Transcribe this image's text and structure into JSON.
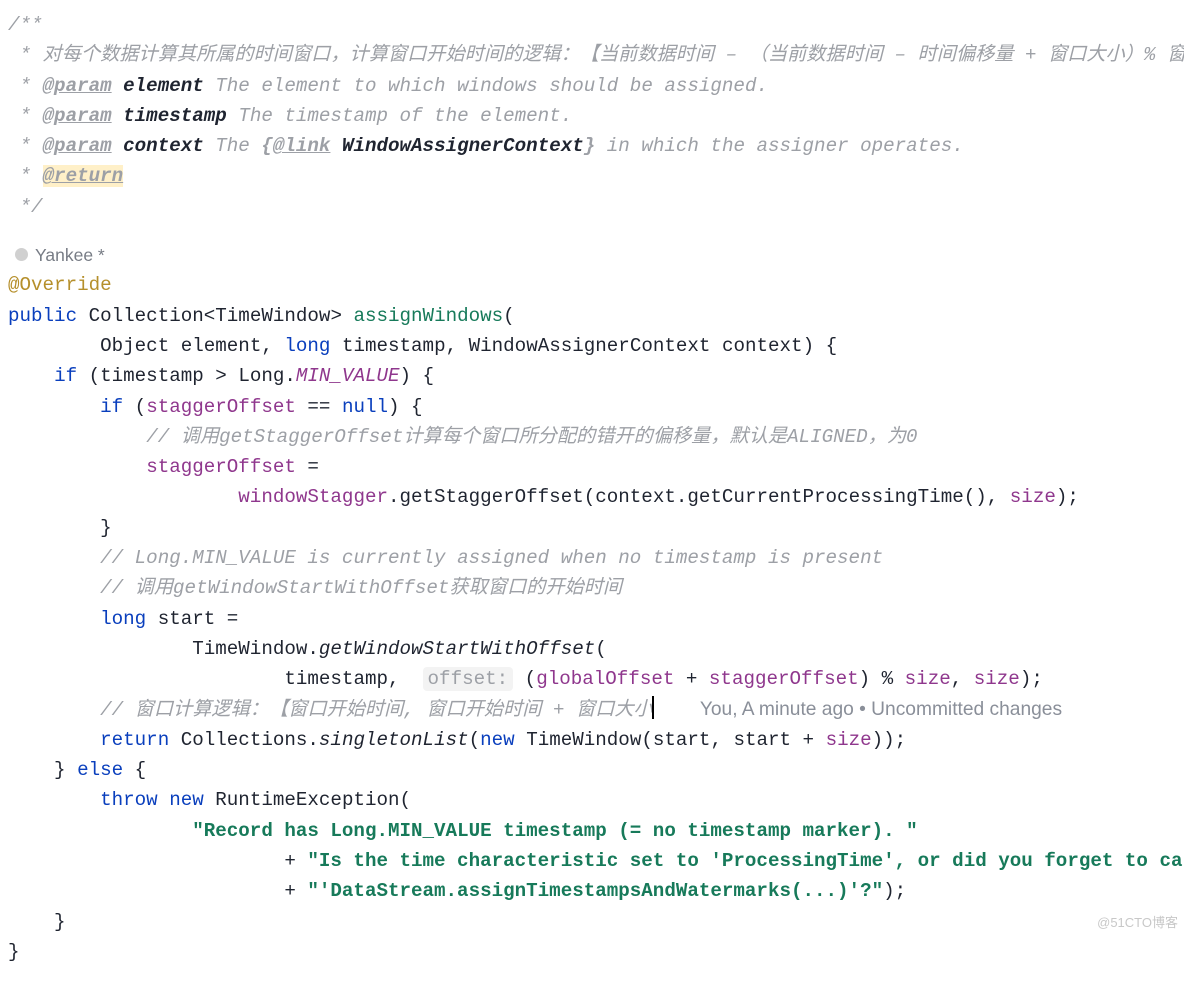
{
  "doc": {
    "open": "/**",
    "desc": " * 对每个数据计算其所属的时间窗口，计算窗口开始时间的逻辑：【当前数据时间 – （当前数据时间 – 时间偏移量 + 窗口大小）% 窗口大小】",
    "p1tag": "@param",
    "p1name": "element",
    "p1text": "The element to which windows should be assigned.",
    "p2tag": "@param",
    "p2name": "timestamp",
    "p2text": "The timestamp of the element.",
    "p3tag": "@param",
    "p3name": "context",
    "p3text_a": "The ",
    "p3brace_o": "{",
    "p3link": "@link",
    "p3linkname": "WindowAssignerContext",
    "p3brace_c": "}",
    "p3text_b": " in which the assigner operates.",
    "rtag": "@return",
    "close": " */"
  },
  "author": "Yankee *",
  "ann": "@Override",
  "kw": {
    "public": "public",
    "long": "long",
    "if": "if",
    "else": "else",
    "return": "return",
    "throw": "throw",
    "new": "new",
    "null": "null"
  },
  "decl": {
    "ret": "Collection",
    "gen": "TimeWindow",
    "name": "assignWindows"
  },
  "sig": {
    "argtype1": "Object",
    "arg1": "element",
    "arg2": "timestamp",
    "argtype3": "WindowAssignerContext",
    "arg3": "context"
  },
  "c1": {
    "l": "timestamp",
    "op": ">",
    "r1": "Long",
    "r2": "MIN_VALUE"
  },
  "c2": {
    "l": "staggerOffset",
    "op": "=="
  },
  "cmt1": "// 调用getStaggerOffset计算每个窗口所分配的错开的偏移量，默认是ALIGNED，为0",
  "as1": {
    "lhs": "staggerOffset",
    "rhs_a": "windowStagger",
    "rhs_m": "getStaggerOffset",
    "rhs_arg1_a": "context",
    "rhs_arg1_m": "getCurrentProcessingTime",
    "rhs_arg2": "size"
  },
  "cmt2": "// Long.MIN_VALUE is currently assigned when no timestamp is present",
  "cmt3": "// 调用getWindowStartWithOffset获取窗口的开始时间",
  "as2": {
    "lhs": "start",
    "rhs_c": "TimeWindow",
    "rhs_m": "getWindowStartWithOffset",
    "a1": "timestamp",
    "hint": "offset:",
    "go": "globalOffset",
    "so": "staggerOffset",
    "sz": "size"
  },
  "active": {
    "cmt": "// 窗口计算逻辑：【窗口开始时间, 窗口开始时间 + 窗口大小",
    "lens": "You, A minute ago • Uncommitted changes"
  },
  "ret": {
    "c": "Collections",
    "m": "singletonList",
    "tw": "TimeWindow",
    "a1": "start",
    "a2": "start",
    "sz": "size"
  },
  "thr": {
    "c": "RuntimeException",
    "s1": "\"Record has Long.MIN_VALUE timestamp (= no timestamp marker). \"",
    "s2": "\"Is the time characteristic set to 'ProcessingTime', or did you forget to call \"",
    "s3": "\"'DataStream.assignTimestampsAndWatermarks(...)'?\""
  },
  "wm": "@51CTO博客"
}
